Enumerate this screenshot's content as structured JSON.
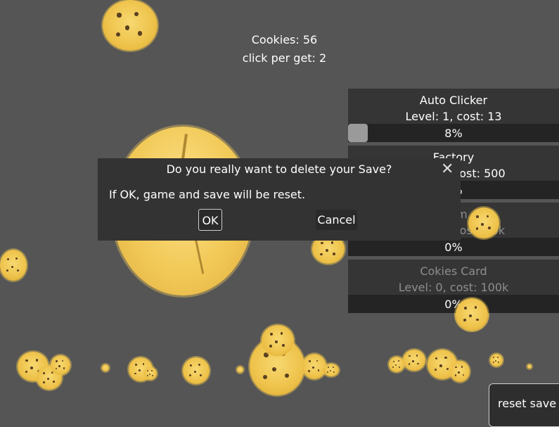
{
  "stats": {
    "cookies": "Cookies: 56",
    "click_per_get": "click per get: 2"
  },
  "upgrades": [
    {
      "name": "Auto Clicker",
      "meta": "Level: 1, cost: 13",
      "percent": "8%",
      "progress": 0.08
    },
    {
      "name": "Factory",
      "meta": "Level: 0, cost: 500",
      "percent": "0%",
      "progress": 0
    },
    {
      "name": "Farm",
      "meta": "Level: 0, cost: 10k",
      "percent": "0%",
      "progress": 0
    },
    {
      "name": "Cokies Card",
      "meta": "Level: 0, cost: 100k",
      "percent": "0%",
      "progress": 0
    }
  ],
  "dialog": {
    "title": "Do you really want to delete your Save?",
    "message": "If OK, game and save will be reset.",
    "ok_label": "OK",
    "cancel_label": "Cancel",
    "close_glyph": "✕"
  },
  "reset_label": "reset save",
  "colors": {
    "background": "#555555",
    "panel": "#353535",
    "cookie": "#f2c957"
  }
}
